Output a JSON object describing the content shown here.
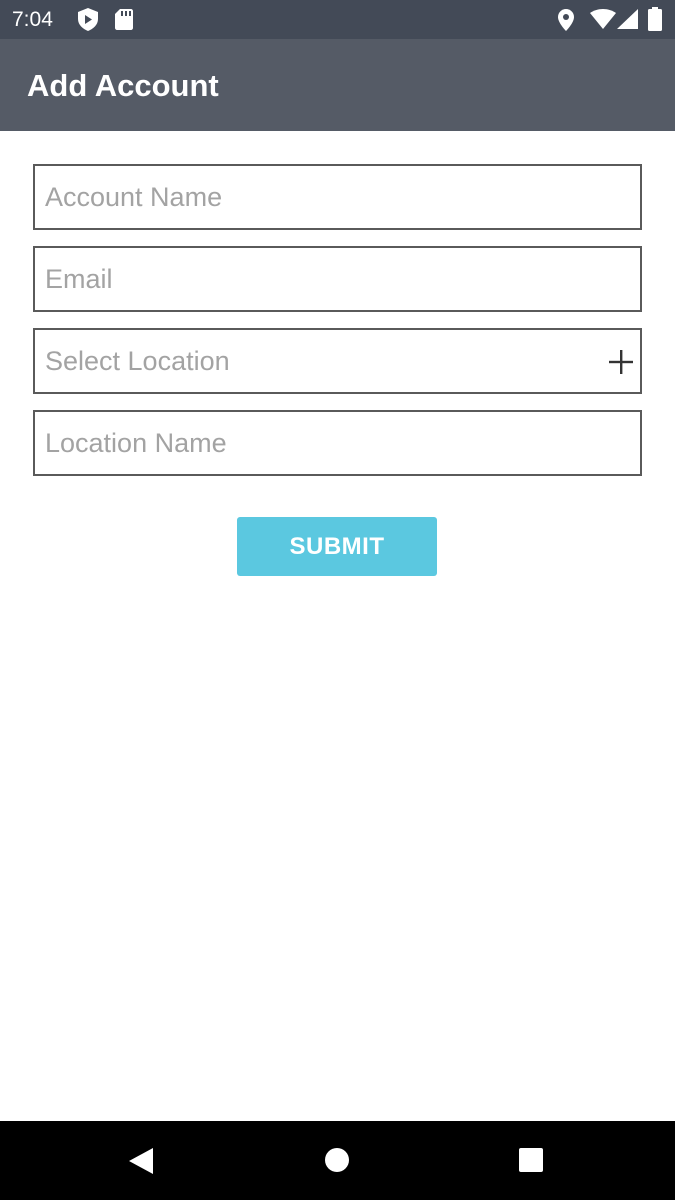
{
  "status_bar": {
    "time": "7:04",
    "icons": [
      "play-protect-icon",
      "sd-card-icon",
      "location-icon",
      "wifi-icon",
      "cellular-signal-icon",
      "battery-icon"
    ]
  },
  "app_bar": {
    "title": "Add Account"
  },
  "form": {
    "account_name": {
      "placeholder": "Account Name",
      "value": ""
    },
    "email": {
      "placeholder": "Email",
      "value": ""
    },
    "select_location": {
      "placeholder": "Select Location",
      "value": "",
      "action_icon": "plus-icon"
    },
    "location_name": {
      "placeholder": "Location Name",
      "value": ""
    },
    "submit_label": "SUBMIT"
  },
  "nav_bar": {
    "buttons": [
      "back-icon",
      "home-icon",
      "recents-icon"
    ]
  },
  "colors": {
    "status_bar": "#434a57",
    "app_bar": "#555b66",
    "accent": "#5bc8e0",
    "field_border": "#5a5a5a",
    "placeholder": "#a3a3a3"
  }
}
